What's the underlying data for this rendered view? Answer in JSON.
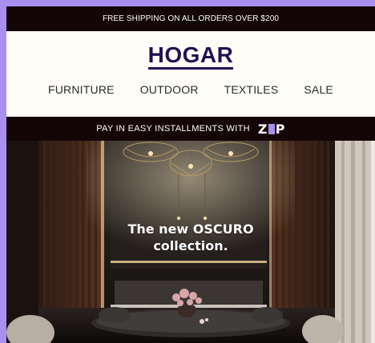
{
  "promo": {
    "text": "FREE SHIPPING ON ALL ORDERS OVER $200"
  },
  "brand": {
    "name": "HOGAR"
  },
  "nav": {
    "items": [
      "FURNITURE",
      "OUTDOOR",
      "TEXTILES",
      "SALE"
    ]
  },
  "installments": {
    "text": "PAY IN EASY INSTALLMENTS WITH",
    "provider_logo": "zip-logo"
  },
  "hero": {
    "line1": "The new OSCURO",
    "line2": "collection."
  },
  "colors": {
    "page_bg": "#a98ff0",
    "dark_bar": "#140507",
    "brand": "#231052",
    "zip_accent": "#a98ff0"
  }
}
